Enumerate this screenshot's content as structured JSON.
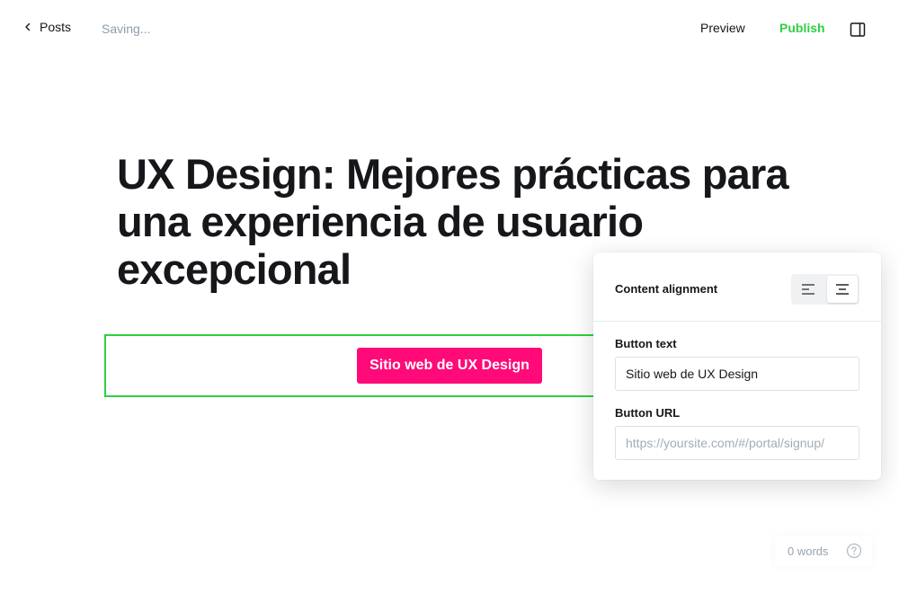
{
  "header": {
    "back_label": "Posts",
    "status_text": "Saving...",
    "preview_label": "Preview",
    "publish_label": "Publish",
    "icons": {
      "back": "chevron-left-icon",
      "sidebar_toggle": "sidebar-panel-icon"
    }
  },
  "post": {
    "title": "UX Design: Mejores prácticas para una experiencia de usuario excepcional"
  },
  "button_card": {
    "button_text": "Sitio web de UX Design",
    "button_color": "#ff0a78",
    "selected_border_color": "#30cf43"
  },
  "settings": {
    "content_alignment_label": "Content alignment",
    "alignment_options": [
      "left",
      "center"
    ],
    "selected_alignment": "center",
    "button_text_label": "Button text",
    "button_text_value": "Sitio web de UX Design",
    "button_url_label": "Button URL",
    "button_url_value": "",
    "button_url_placeholder": "https://yoursite.com/#/portal/signup/"
  },
  "footer": {
    "word_count": "0 words",
    "help_icon": "help-circle-icon"
  },
  "colors": {
    "accent_green": "#30cf43",
    "text_dark": "#15171a",
    "muted": "#8e9cac"
  }
}
